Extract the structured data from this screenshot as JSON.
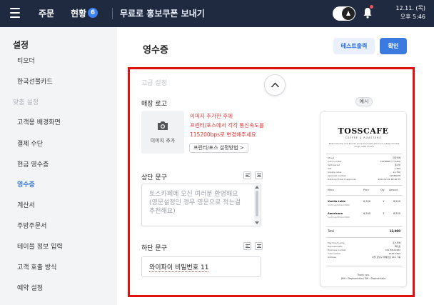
{
  "topbar": {
    "order": "주문",
    "status": "현황",
    "status_badge": "6",
    "promo": "무료로 홍보쿠폰 보내기",
    "date": "12.11. (목)",
    "time": "오후 5:46"
  },
  "sidebar": {
    "title": "설정",
    "items": [
      "티오더",
      "한국선불카드",
      "맞춤 설정",
      "고객용 배경화면",
      "결제 수단",
      "현금 영수증",
      "영수증",
      "계산서",
      "주방주문서",
      "테이블 정보 입력",
      "고객 호출 방식",
      "예약 설정"
    ]
  },
  "main": {
    "title": "영수증",
    "test_print": "테스트출력",
    "confirm": "확인",
    "advanced_settings": "고급 설정",
    "store_logo": "매장 로고",
    "add_image": "이미지 추가",
    "logo_warning": [
      "이미지 추가한 후에",
      "프린터/포스에서 각각 통신속도를",
      "115200bps로 변경해주세요"
    ],
    "printer_guide": "프린터/포스 설정방법 >",
    "top_text_label": "상단 문구",
    "top_text_placeholder": "토스카페에 오신 여러분 환영해요 (영문설정인 경우 영문으로 적는걸 추천해요)",
    "bottom_text_label": "하단 문구",
    "bottom_text_value": "와이파이 비밀번호 11",
    "example": "예시"
  },
  "receipt": {
    "logo": "TOSSCAFE",
    "subtitle": "COFFEE & ROASTERS",
    "desc": "Red instructs, one kouran lours food instructions in a few minutes drugs, latte drums",
    "rows_top": [
      {
        "k": "Street",
        "v": "진한카페"
      },
      {
        "k": "Card number",
        "v": "1234888*****3456"
      },
      {
        "k": "Split-period",
        "v": "일시불"
      },
      {
        "k": "VAT",
        "v": "1,300"
      },
      {
        "k": "Supply value",
        "v": "11,700"
      },
      {
        "k": "Approval number",
        "v": "12345678"
      },
      {
        "k": "Date and time of approval",
        "v": "2021.12.01 18:40:35"
      }
    ],
    "head": {
      "menu": "Menu",
      "price": "Price",
      "qty": "Qty",
      "amount": "Amount"
    },
    "items": [
      {
        "name": "Vanilla Latte",
        "opt": "Iced/Cup/Whole(3000)",
        "price": "6,500",
        "qty": "1",
        "amount": "6,500"
      },
      {
        "name": "Americano",
        "opt": "Iced/Cup/Whole(3000)",
        "price": "6,500",
        "qty": "1",
        "amount": "6,500"
      }
    ],
    "total_label": "Total",
    "total_value": "13,000",
    "rows_bottom": [
      {
        "k": "Merchant name",
        "v": "토스카페"
      },
      {
        "k": "Representativ",
        "v": "최대표"
      },
      {
        "k": "Business number",
        "v": "031-88-02482"
      },
      {
        "k": "Call number",
        "v": "1644-0369"
      },
      {
        "k": "Address",
        "v": "서울 강남구 테헤란로 142, 7층"
      }
    ],
    "thanks": "Thank you.",
    "social": "Wifi : Stephenhello / PW : Stephenhello"
  }
}
